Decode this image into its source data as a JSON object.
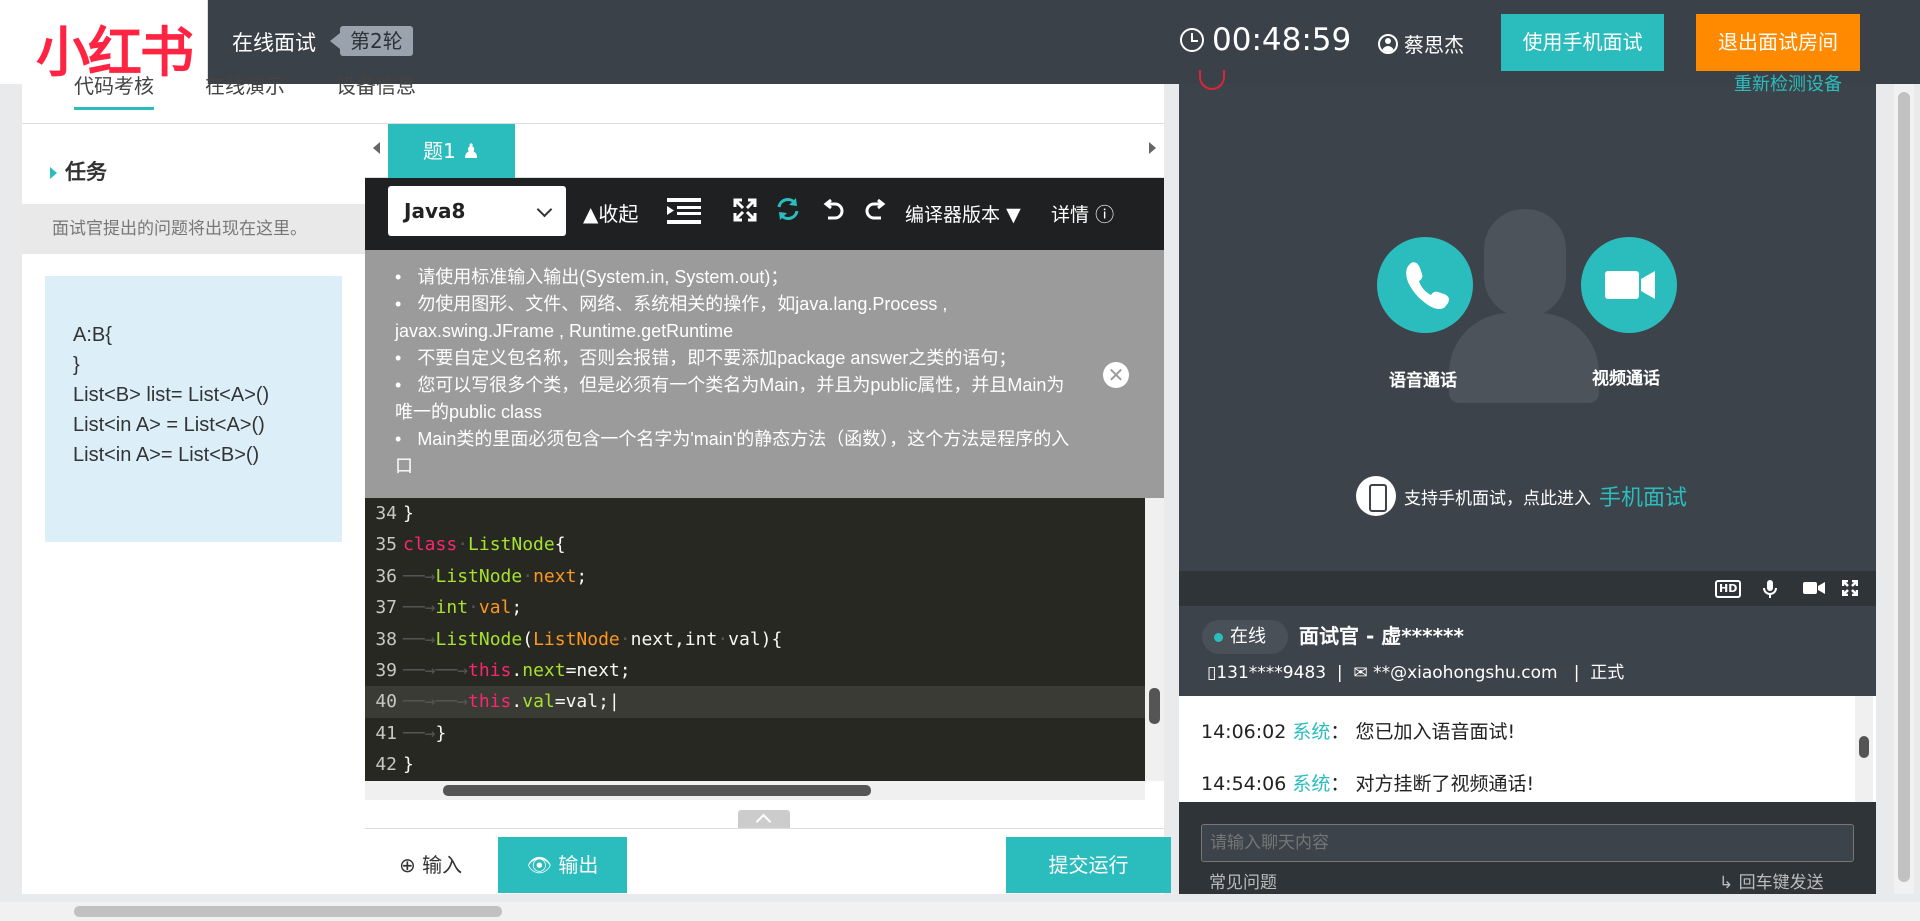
{
  "header": {
    "logo_text": "小红书",
    "title": "在线面试",
    "round_badge": "第2轮",
    "timer": "00:48:59",
    "user_name": "蔡思杰",
    "mobile_button": "使用手机面试",
    "exit_button": "退出面试房间"
  },
  "tabs": [
    "代码考核",
    "在线演示",
    "设备信息"
  ],
  "task": {
    "title": "任务",
    "hint": "面试官提出的问题将出现在这里。",
    "lines": [
      "A:B{",
      "}",
      "List<B> list= List<A>()",
      "List<in A> = List<A>()",
      "List<in A>= List<B>()"
    ]
  },
  "editor": {
    "question_tab": "题1",
    "language": "Java8",
    "collapse_label": "收起",
    "compiler_label": "编译器版本",
    "detail_label": "详情",
    "notice": [
      "请使用标准输入输出(System.in, System.out)；",
      "勿使用图形、文件、网络、系统相关的操作，如java.lang.Process , javax.swing.JFrame , Runtime.getRuntime",
      "不要自定义包名称，否则会报错，即不要添加package answer之类的语句；",
      "您可以写很多个类，但是必须有一个类名为Main，并且为public属性，并且Main为唯一的public class",
      "Main类的里面必须包含一个名字为'main'的静态方法（函数），这个方法是程序的入口"
    ],
    "code_line_numbers": [
      "34",
      "35",
      "36",
      "37",
      "38",
      "39",
      "40",
      "41",
      "42"
    ],
    "input_label": "输入",
    "output_label": "输出",
    "submit_label": "提交运行"
  },
  "right": {
    "top_link": "重新检测设备",
    "voice_call_label": "语音通话",
    "video_call_label": "视频通话",
    "mobile_hint": "支持手机面试，点此进入",
    "mobile_link": "手机面试",
    "online_label": "在线",
    "interviewer": "面试官 - 虚******",
    "phone": "131****9483",
    "email": "**@xiaohongshu.com",
    "status": "正式",
    "chat": [
      {
        "time": "14:06:02",
        "sender": "系统",
        "message": "您已加入语音面试!"
      },
      {
        "time": "14:54:06",
        "sender": "系统",
        "message": "对方挂断了视频通话!"
      }
    ],
    "chat_placeholder": "请输入聊天内容",
    "faq_link": "常见问题",
    "enter_hint": "回车键发送"
  }
}
